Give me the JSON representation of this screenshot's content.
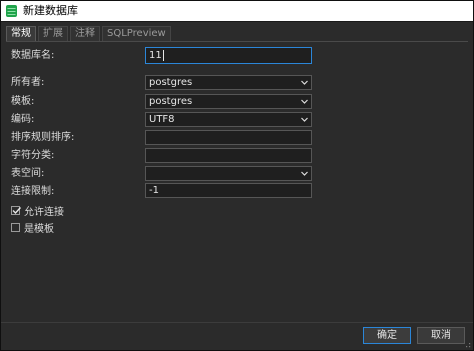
{
  "window": {
    "title": "新建数据库"
  },
  "tabs": [
    {
      "label": "常规"
    },
    {
      "label": "扩展"
    },
    {
      "label": "注释"
    },
    {
      "label": "SQLPreview"
    }
  ],
  "form": {
    "db_name": {
      "label": "数据库名:",
      "value": "11"
    },
    "owner": {
      "label": "所有者:",
      "value": "postgres"
    },
    "template": {
      "label": "模板:",
      "value": "postgres"
    },
    "encoding": {
      "label": "编码:",
      "value": "UTF8"
    },
    "collation": {
      "label": "排序规则排序:",
      "value": ""
    },
    "ctype": {
      "label": "字符分类:",
      "value": ""
    },
    "tablespace": {
      "label": "表空间:",
      "value": ""
    },
    "conn_limit": {
      "label": "连接限制:",
      "value": "-1"
    },
    "allow_conn": {
      "label": "允许连接",
      "checked": true
    },
    "is_template": {
      "label": "是模板",
      "checked": false
    }
  },
  "buttons": {
    "ok": "确定",
    "cancel": "取消"
  },
  "colors": {
    "background": "#2b2b2b",
    "accent": "#2b86d8",
    "icon_green": "#1fa34a"
  }
}
